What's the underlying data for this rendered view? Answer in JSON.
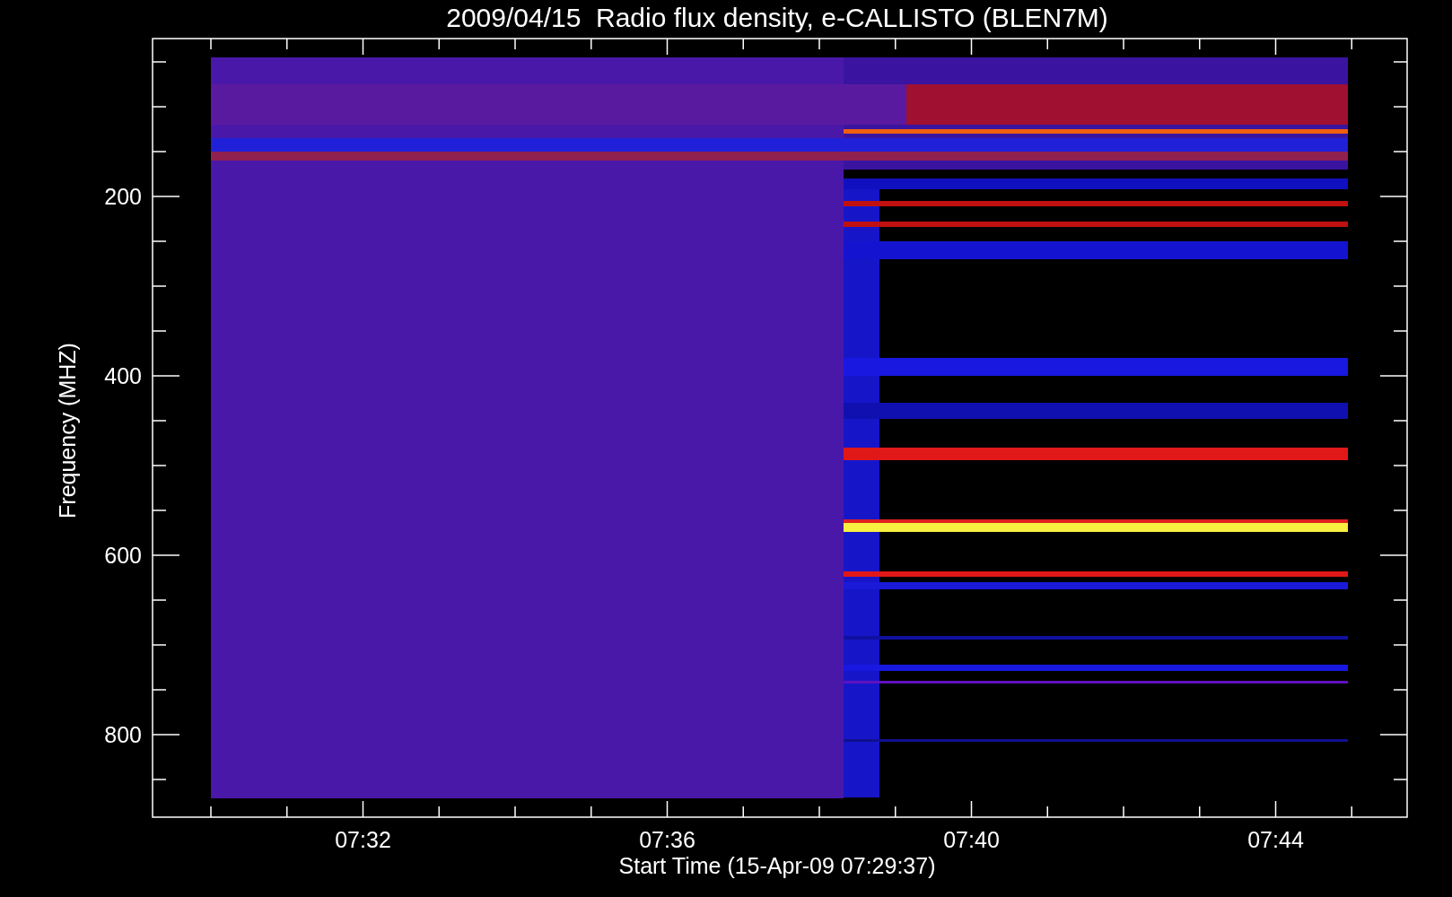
{
  "title": "2009/04/15  Radio flux density, e-CALLISTO (BLEN7M)",
  "y_axis": {
    "label": "Frequency (MHZ)",
    "ticks": [
      "200",
      "400",
      "600",
      "800"
    ]
  },
  "x_axis": {
    "label": "Start Time (15-Apr-09 07:29:37)",
    "ticks": [
      "07:32",
      "07:36",
      "07:40",
      "07:44"
    ]
  }
}
